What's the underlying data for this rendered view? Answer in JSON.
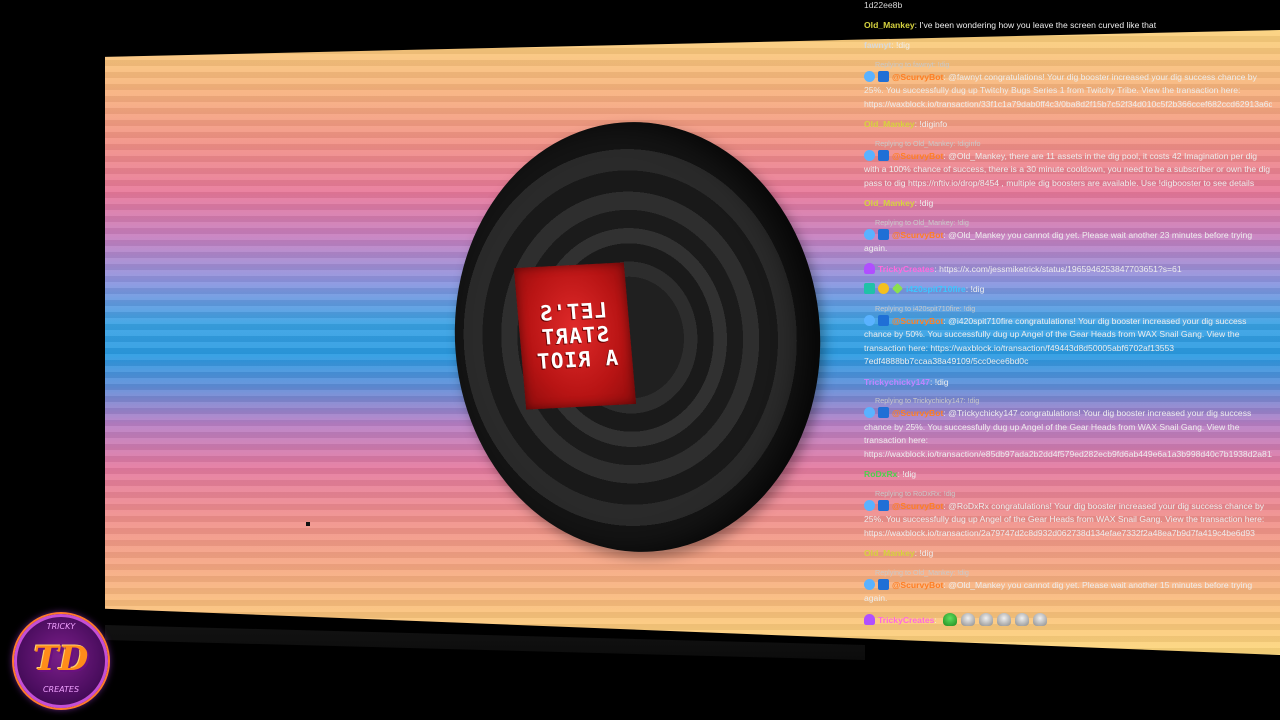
{
  "stream": {
    "tire_sign_lines": [
      "LET'S",
      "START",
      "A RIOT"
    ]
  },
  "logo": {
    "letters": "TD",
    "ring_top": "TRICKY",
    "ring_bottom": "CREATES"
  },
  "chat": {
    "top_id": "1d22ee8b",
    "messages": [
      {
        "user": "Old_Mankey",
        "user_class": "u-old",
        "text": "I've been wondering how you leave the screen curved like that"
      },
      {
        "user": "fawnyt",
        "user_class": "u-fawny",
        "text": "!dig"
      },
      {
        "reply": "Replying to fawnyt: !dig",
        "user": "@ScurvyBot",
        "user_class": "u-bot",
        "badges": [
          "b-bot",
          "b-bot2"
        ],
        "text": "@fawnyt congratulations! Your dig booster increased your dig success chance by 25%. You successfully dug up Twitchy Bugs Series 1 from Twitchy Tribe. View the transaction here: https://waxblock.io/transaction/33f1c1a79dab0ff4c3/0ba8d2f15b7c52f34d010c5f2b366ccef682ccd62913a6d"
      },
      {
        "user": "Old_Mankey",
        "user_class": "u-old",
        "text": "!diginfo"
      },
      {
        "reply": "Replying to Old_Mankey: !diginfo",
        "user": "@ScurvyBot",
        "user_class": "u-bot",
        "badges": [
          "b-bot",
          "b-bot2"
        ],
        "text": "@Old_Mankey, there are 11 assets in the dig pool, it costs 42 Imagination per dig with a 100% chance of success, there is a 30 minute cooldown, you need to be a subscriber or own the dig pass to dig https://nftiv.io/drop/8454 , multiple dig boosters are available. Use !digbooster to see details"
      },
      {
        "user": "Old_Mankey",
        "user_class": "u-old",
        "text": "!dig"
      },
      {
        "reply": "Replying to Old_Mankey: !dig",
        "user": "@ScurvyBot",
        "user_class": "u-bot",
        "badges": [
          "b-bot",
          "b-bot2"
        ],
        "text": "@Old_Mankey you cannot dig yet. Please wait another 23 minutes before trying again."
      },
      {
        "user": "TrickyCreates",
        "user_class": "u-tricky",
        "badges": [
          "b-purple"
        ],
        "text": "https://x.com/jessmiketrick/status/1965946253847703651?s=61"
      },
      {
        "user": "i420spit710fire",
        "user_class": "u-420",
        "badges": [
          "b-sub",
          "b-coin",
          "b-diamond"
        ],
        "text": "!dig"
      },
      {
        "reply": "Replying to i420spit710fire: !dig",
        "user": "@ScurvyBot",
        "user_class": "u-bot",
        "badges": [
          "b-bot",
          "b-bot2"
        ],
        "text": "@i420spit710fire congratulations! Your dig booster increased your dig success chance by 50%. You successfully dug up Angel of the Gear Heads from WAX Snail Gang. View the transaction here: https://waxblock.io/transaction/f49443d8d50005abf6702af13553 7edf4888bb7ccaa38a49109/5cc0ece6bd0c"
      },
      {
        "user": "Trickychicky147",
        "user_class": "u-trickychicky",
        "text": "!dig"
      },
      {
        "reply": "Replying to Trickychicky147: !dig",
        "user": "@ScurvyBot",
        "user_class": "u-bot",
        "badges": [
          "b-bot",
          "b-bot2"
        ],
        "text": "@Trickychicky147 congratulations! Your dig booster increased your dig success chance by 25%. You successfully dug up Angel of the Gear Heads from WAX Snail Gang. View the transaction here: https://waxblock.io/transaction/e85db97ada2b2dd4f579ed282ecb9fd6ab449e6a1a3b998d40c7b1938d2a8111"
      },
      {
        "user": "RoDxRx",
        "user_class": "u-redxr",
        "text": "!dig"
      },
      {
        "reply": "Replying to RoDxRx: !dig",
        "user": "@ScurvyBot",
        "user_class": "u-bot",
        "badges": [
          "b-bot",
          "b-bot2"
        ],
        "text": "@RoDxRx congratulations! Your dig booster increased your dig success chance by 25%. You successfully dug up Angel of the Gear Heads from WAX Snail Gang. View the transaction here: https://waxblock.io/transaction/2a79747d2c8d932d062738d134efae7332f2a48ea7b9d7fa419c4be6d93"
      },
      {
        "user": "Old_Mankey",
        "user_class": "u-old",
        "text": "!dig"
      },
      {
        "reply": "Replying to Old_Mankey: !dig",
        "user": "@ScurvyBot",
        "user_class": "u-bot",
        "badges": [
          "b-bot",
          "b-bot2"
        ],
        "text": "@Old_Mankey you cannot dig yet. Please wait another 15 minutes before trying again."
      },
      {
        "user": "TrickyCreates",
        "user_class": "u-tricky",
        "badges": [
          "b-purple"
        ],
        "text": "",
        "emotes": [
          "e-green",
          "e-gray",
          "e-gray",
          "e-gray",
          "e-gray",
          "e-gray"
        ]
      }
    ]
  }
}
